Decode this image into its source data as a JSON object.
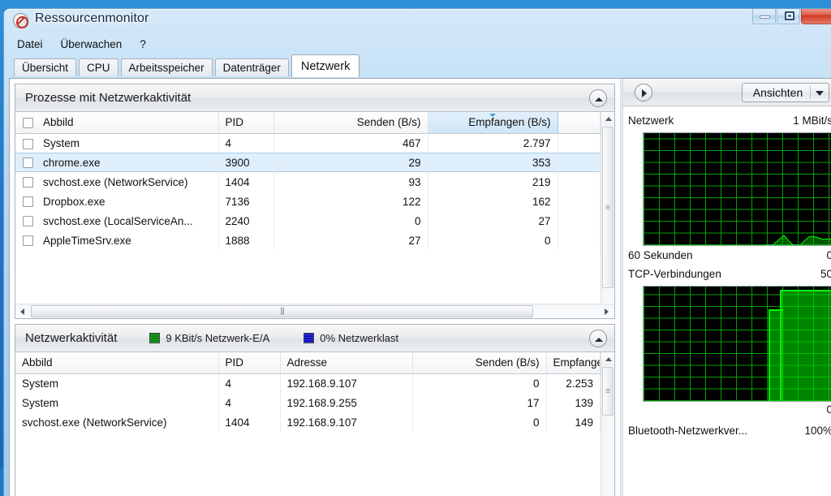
{
  "window": {
    "title": "Ressourcenmonitor",
    "icon": "resource-monitor-icon",
    "controls": {
      "minimize": "Minimieren",
      "restore": "Wiederherstellen",
      "close": "Schließen"
    }
  },
  "menubar": {
    "items": [
      "Datei",
      "Überwachen",
      "?"
    ]
  },
  "tabs": {
    "items": [
      {
        "label": "Übersicht",
        "active": false
      },
      {
        "label": "CPU",
        "active": false
      },
      {
        "label": "Arbeitsspeicher",
        "active": false
      },
      {
        "label": "Datenträger",
        "active": false
      },
      {
        "label": "Netzwerk",
        "active": true
      }
    ]
  },
  "processes_panel": {
    "title": "Prozesse mit Netzwerkaktivität",
    "columns": [
      "Abbild",
      "PID",
      "Senden (B/s)",
      "Empfangen (B/s)"
    ],
    "sorted_column": "Empfangen (B/s)",
    "sort_direction": "descending",
    "rows": [
      {
        "checked": false,
        "image": "System",
        "pid": "4",
        "send": "467",
        "receive": "2.797",
        "selected": false
      },
      {
        "checked": false,
        "image": "chrome.exe",
        "pid": "3900",
        "send": "29",
        "receive": "353",
        "selected": true
      },
      {
        "checked": false,
        "image": "svchost.exe (NetworkService)",
        "pid": "1404",
        "send": "93",
        "receive": "219",
        "selected": false
      },
      {
        "checked": false,
        "image": "Dropbox.exe",
        "pid": "7136",
        "send": "122",
        "receive": "162",
        "selected": false
      },
      {
        "checked": false,
        "image": "svchost.exe (LocalServiceAn...",
        "pid": "2240",
        "send": "0",
        "receive": "27",
        "selected": false
      },
      {
        "checked": false,
        "image": "AppleTimeSrv.exe",
        "pid": "1888",
        "send": "27",
        "receive": "0",
        "selected": false
      }
    ]
  },
  "activity_panel": {
    "title": "Netzwerkaktivität",
    "legend": [
      {
        "color": "#0a7a0a",
        "label": "9 KBit/s Netzwerk-E/A"
      },
      {
        "color": "#0a0ab0",
        "label": "0% Netzwerklast"
      }
    ],
    "columns": [
      "Abbild",
      "PID",
      "Adresse",
      "Senden (B/s)",
      "Empfangen (B/s)"
    ],
    "rows": [
      {
        "image": "System",
        "pid": "4",
        "address": "192.168.9.107",
        "send": "0",
        "receive": "2.253"
      },
      {
        "image": "System",
        "pid": "4",
        "address": "192.168.9.255",
        "send": "17",
        "receive": "139"
      },
      {
        "image": "svchost.exe (NetworkService)",
        "pid": "1404",
        "address": "192.168.9.107",
        "send": "0",
        "receive": "149"
      }
    ]
  },
  "right_panel": {
    "toolbar": {
      "expand_icon": "chevron-right-icon",
      "views_button": "Ansichten",
      "views_arrow": "chevron-down-icon"
    },
    "graphs": [
      {
        "name": "Netzwerk",
        "scale_max": "1 MBit/s",
        "axis_bottom_left": "60 Sekunden",
        "axis_bottom_right": "0"
      },
      {
        "name": "TCP-Verbindungen",
        "scale_max": "50",
        "axis_bottom_left": "",
        "axis_bottom_right": "0"
      }
    ],
    "next_graph_label": "Bluetooth-Netzwerkver...",
    "next_graph_scale": "100%"
  },
  "chart_data": [
    {
      "type": "area",
      "title": "Netzwerk",
      "ylabel": "",
      "xlabel": "60 Sekunden",
      "ylim": [
        0,
        1
      ],
      "unit": "MBit/s",
      "grid": true,
      "x": [
        0,
        5,
        10,
        15,
        20,
        25,
        30,
        35,
        40,
        45,
        50,
        52,
        54,
        56,
        58,
        60
      ],
      "values": [
        0,
        0,
        0,
        0,
        0,
        0,
        0,
        0,
        0,
        0,
        0,
        0.06,
        0.02,
        0.05,
        0.04,
        0.03
      ]
    },
    {
      "type": "area",
      "title": "TCP-Verbindungen",
      "ylabel": "",
      "xlabel": "",
      "ylim": [
        0,
        50
      ],
      "unit": "Verbindungen",
      "grid": true,
      "x": [
        0,
        5,
        10,
        15,
        20,
        25,
        30,
        35,
        40,
        44,
        46,
        48,
        50,
        55,
        60
      ],
      "values": [
        0,
        0,
        0,
        0,
        0,
        0,
        0,
        0,
        0,
        0,
        41,
        48,
        50,
        49,
        48
      ]
    }
  ]
}
